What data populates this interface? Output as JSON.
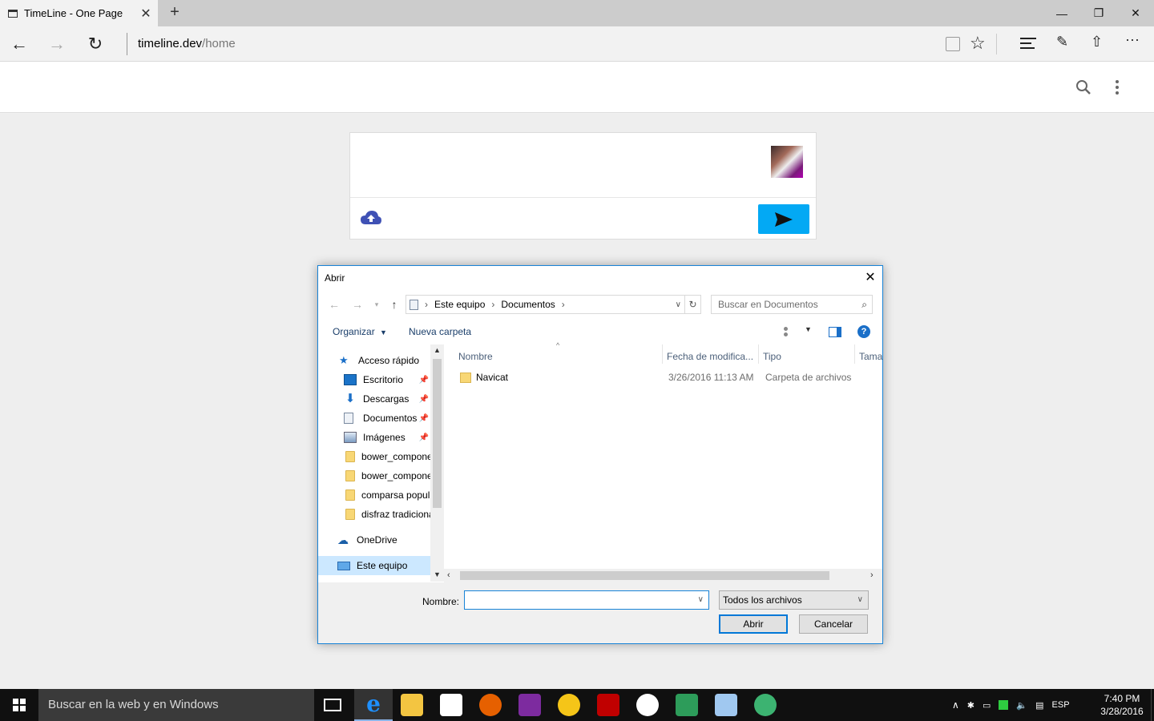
{
  "browser": {
    "tab_title": "TimeLine - One Page",
    "tab_close": "✕",
    "new_tab": "+",
    "minimize": "—",
    "maximize": "❐",
    "close": "✕",
    "back": "←",
    "forward": "→",
    "refresh": "↻",
    "url_host": "timeline.dev",
    "url_path": "/home",
    "more": "···"
  },
  "dialog": {
    "title": "Abrir",
    "close": "✕",
    "breadcrumb": [
      "Este equipo",
      "Documentos"
    ],
    "search_placeholder": "Buscar en Documentos",
    "organize_label": "Organizar",
    "new_folder_label": "Nueva carpeta",
    "help_label": "?",
    "nav": {
      "quick_access": "Acceso rápido",
      "items": [
        {
          "label": "Escritorio",
          "icon": "desktop-icon",
          "pinned": true
        },
        {
          "label": "Descargas",
          "icon": "download-icon",
          "pinned": true
        },
        {
          "label": "Documentos",
          "icon": "document-icon",
          "pinned": true
        },
        {
          "label": "Imágenes",
          "icon": "pictures-icon",
          "pinned": true
        },
        {
          "label": "bower_compone",
          "icon": "folder-icon",
          "pinned": false
        },
        {
          "label": "bower_compone",
          "icon": "folder-icon",
          "pinned": false
        },
        {
          "label": "comparsa popul",
          "icon": "folder-icon",
          "pinned": false
        },
        {
          "label": "disfraz tradiciona",
          "icon": "folder-icon",
          "pinned": false
        }
      ],
      "onedrive": "OneDrive",
      "this_pc": "Este equipo"
    },
    "columns": [
      "Nombre",
      "Fecha de modifica...",
      "Tipo",
      "Tama"
    ],
    "files": [
      {
        "name": "Navicat",
        "date": "3/26/2016 11:13 AM",
        "type": "Carpeta de archivos"
      }
    ],
    "filename_label": "Nombre:",
    "filename_value": "",
    "filter_value": "Todos los archivos",
    "open_button": "Abrir",
    "cancel_button": "Cancelar"
  },
  "taskbar": {
    "search_placeholder": "Buscar en la web y en Windows",
    "lang": "ESP",
    "time": "7:40 PM",
    "date": "3/28/2016"
  }
}
